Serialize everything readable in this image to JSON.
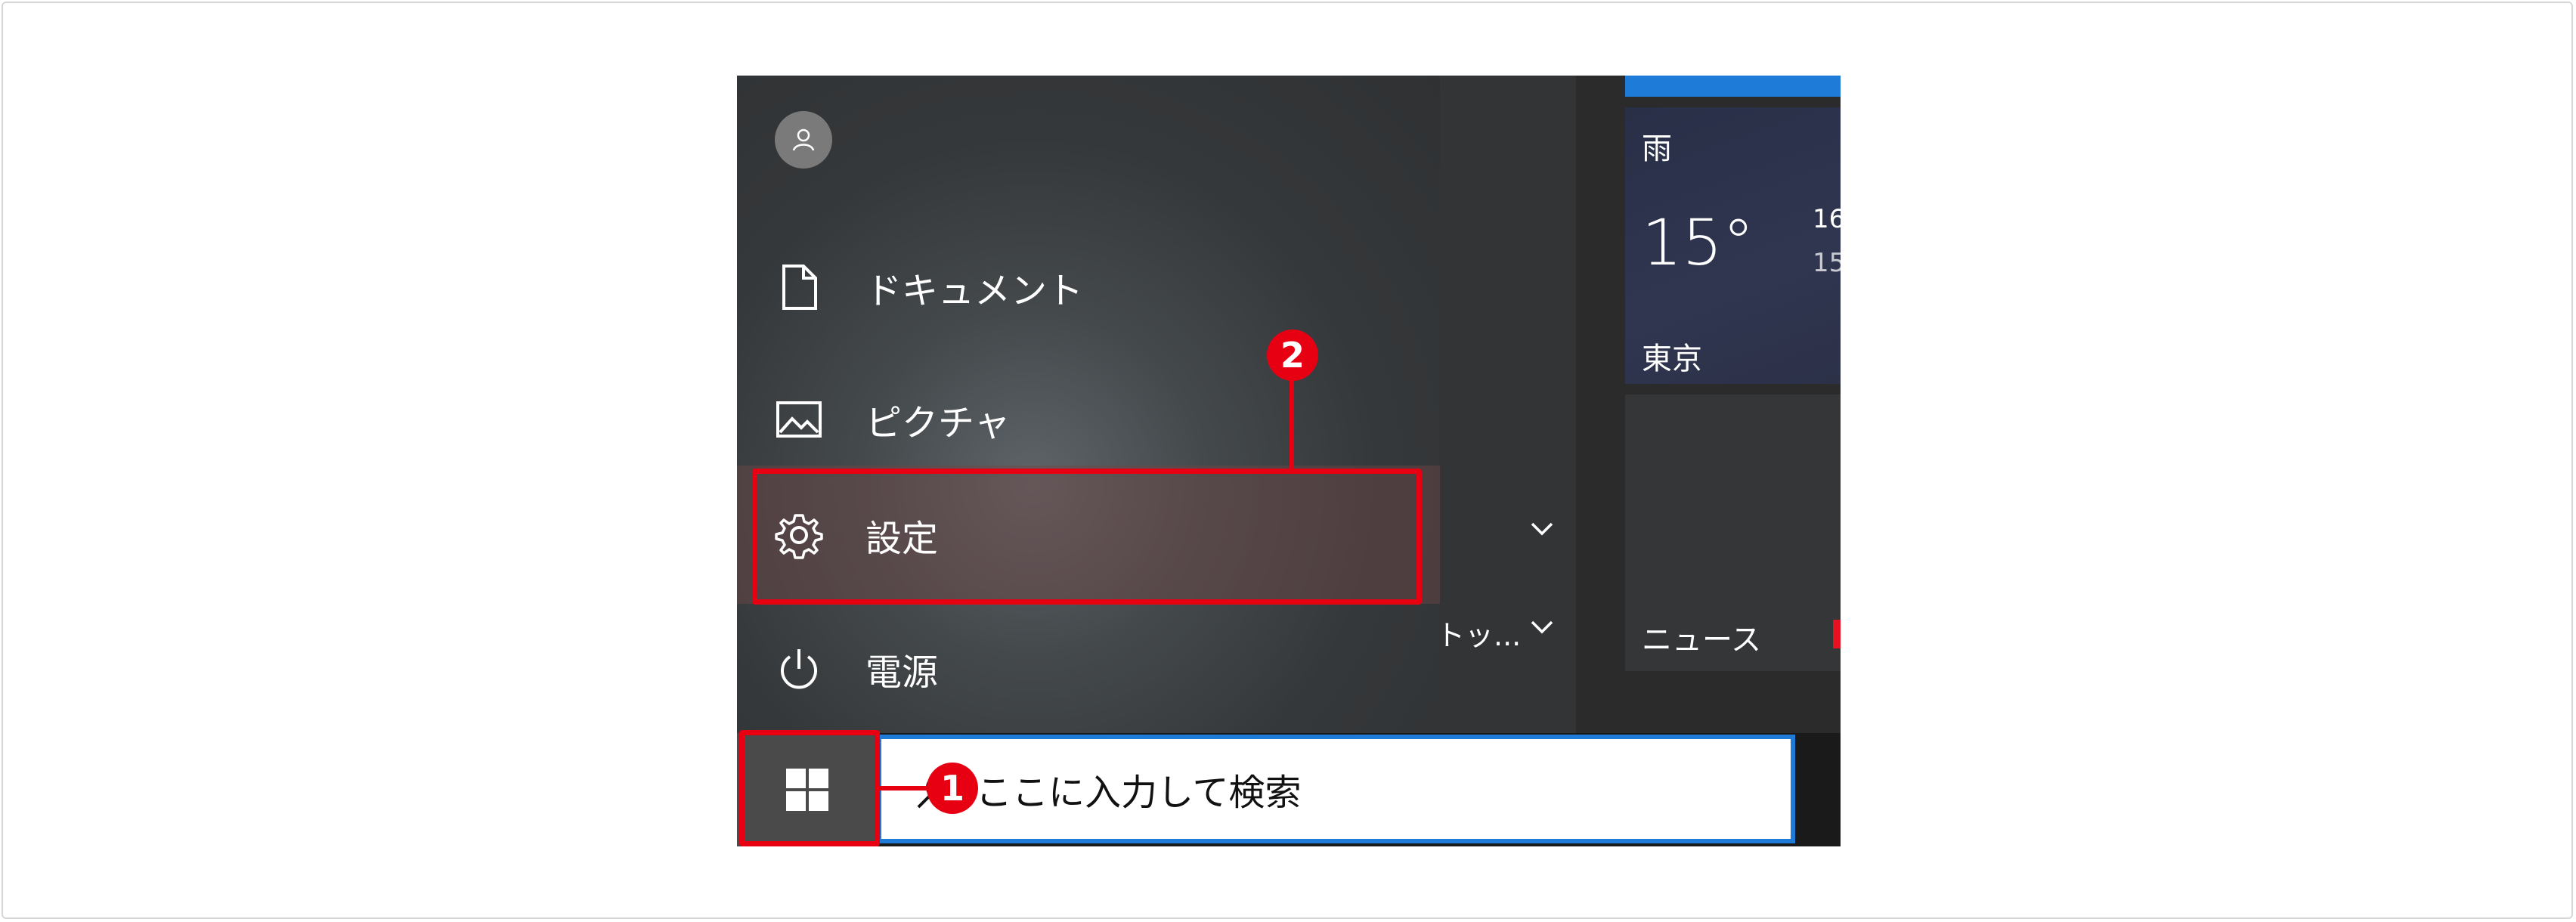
{
  "menu": {
    "items": [
      {
        "label": "ドキュメント",
        "icon": "document-icon"
      },
      {
        "label": "ピクチャ",
        "icon": "picture-icon"
      },
      {
        "label": "設定",
        "icon": "gear-icon"
      },
      {
        "label": "電源",
        "icon": "power-icon"
      }
    ],
    "account_icon": "user-icon"
  },
  "middle": {
    "truncated_label": "トッ..."
  },
  "tiles": {
    "weather": {
      "condition": "雨",
      "temperature": "15°",
      "high": "16",
      "low": "15",
      "city": "東京"
    },
    "news": {
      "label": "ニュース"
    }
  },
  "taskbar": {
    "start_icon": "windows-logo-icon",
    "search_placeholder": "ここに入力して検索"
  },
  "callouts": {
    "one": "1",
    "two": "2"
  },
  "colors": {
    "accent": "#1e7bd7",
    "callout": "#e60012"
  }
}
